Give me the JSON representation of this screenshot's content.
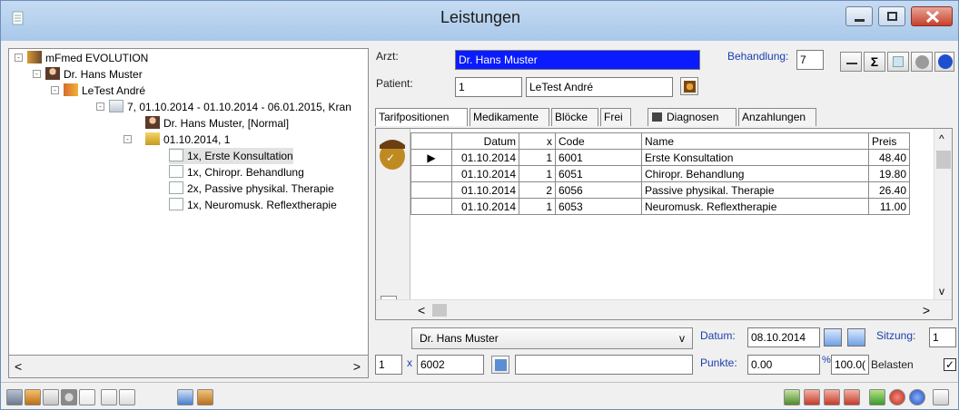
{
  "window": {
    "title": "Leistungen"
  },
  "tree": [
    {
      "label": "mFmed EVOLUTION",
      "icon": "app-logo-icon"
    },
    {
      "label": "Dr. Hans Muster",
      "icon": "doctor-icon"
    },
    {
      "label": "LeTest André",
      "icon": "patient-icon"
    },
    {
      "label": "7, 01.10.2014 - 01.10.2014 - 06.01.2015, Kran",
      "icon": "treatment-icon"
    },
    {
      "label": "Dr. Hans Muster, [Normal]",
      "icon": "doctor-icon"
    },
    {
      "label": "01.10.2014, 1",
      "icon": "folder-icon"
    },
    {
      "label": "1x, Erste Konsultation",
      "icon": "document-icon"
    },
    {
      "label": "1x, Chiropr. Behandlung",
      "icon": "document-icon"
    },
    {
      "label": "2x, Passive physikal. Therapie",
      "icon": "document-icon"
    },
    {
      "label": "1x, Neuromusk. Reflextherapie",
      "icon": "document-icon"
    }
  ],
  "form": {
    "arzt_label": "Arzt:",
    "arzt_value": "Dr. Hans Muster",
    "patient_label": "Patient:",
    "patient_id": "1",
    "patient_name": "LeTest André",
    "behandlung_label": "Behandlung:",
    "behandlung_value": "7",
    "sigma": "Σ"
  },
  "tabs": [
    "Tarifpositionen",
    "Medikamente",
    "Blöcke",
    "Frei",
    "Diagnosen",
    "Anzahlungen"
  ],
  "table": {
    "columns": [
      "Datum",
      "x",
      "Code",
      "Name",
      "Preis"
    ],
    "rows": [
      [
        "01.10.2014",
        "1",
        "6001",
        "Erste Konsultation",
        "48.40"
      ],
      [
        "01.10.2014",
        "1",
        "6051",
        "Chiropr. Behandlung",
        "19.80"
      ],
      [
        "01.10.2014",
        "2",
        "6056",
        "Passive physikal. Therapie",
        "26.40"
      ],
      [
        "01.10.2014",
        "1",
        "6053",
        "Neuromusk. Reflextherapie",
        "11.00"
      ]
    ]
  },
  "entry": {
    "arzt_select": "Dr. Hans Muster",
    "datum_label": "Datum:",
    "datum_value": "08.10.2014",
    "sitzung_label": "Sitzung:",
    "sitzung_value": "1",
    "qty_value": "1",
    "x_label": "x",
    "code_value": "6002",
    "punkte_label": "Punkte:",
    "punkte_value": "0.00",
    "percent_label": "%",
    "percent_value": "100.0(",
    "belasten_label": "Belasten",
    "belasten_checked": "✓"
  },
  "scroll_glyphs": {
    "left": "<",
    "right": ">",
    "up": "^",
    "down": "v",
    "combo": "v",
    "expand": "-"
  }
}
